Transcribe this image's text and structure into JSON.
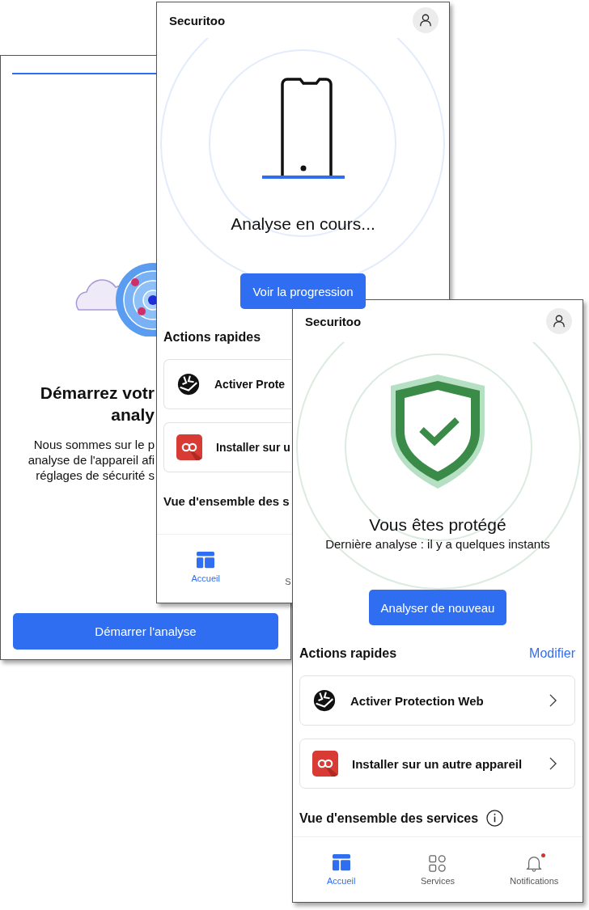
{
  "screens": [
    {
      "kind": "start",
      "title_lines": [
        "Démarrez votr",
        "analy"
      ],
      "body_lines": [
        "Nous sommes sur le p",
        "analyse de l'appareil afi",
        "réglages de sécurité s"
      ],
      "button": "Démarrer l'analyse"
    },
    {
      "kind": "scanning",
      "app_name": "Securitoo",
      "status": "Analyse en cours...",
      "button": "Voir la progression",
      "section_title": "Actions rapides",
      "actions": [
        {
          "label": "Activer Prote"
        },
        {
          "label": "Installer sur u"
        }
      ],
      "overview_title": "Vue d'ensemble des s",
      "nav": [
        {
          "kind": "tab",
          "label": "Accueil",
          "selected": true
        },
        {
          "kind": "cut",
          "label": "S",
          "selected": false
        }
      ]
    },
    {
      "kind": "protected",
      "app_name": "Securitoo",
      "status": "Vous êtes protégé",
      "last_scan": "Dernière analyse : il y a quelques instants",
      "button": "Analyser de nouveau",
      "section_title": "Actions rapides",
      "section_link": "Modifier",
      "actions": [
        {
          "label": "Activer Protection Web",
          "chevron": true
        },
        {
          "label": "Installer sur un autre appareil",
          "chevron": true
        }
      ],
      "overview_title": "Vue d'ensemble des services",
      "overview_info": true,
      "nav": [
        {
          "kind": "tab",
          "label": "Accueil",
          "selected": true
        },
        {
          "kind": "tab",
          "label": "Services",
          "selected": false
        },
        {
          "kind": "tab",
          "label": "Notifications",
          "selected": false,
          "badge": true
        }
      ]
    }
  ]
}
